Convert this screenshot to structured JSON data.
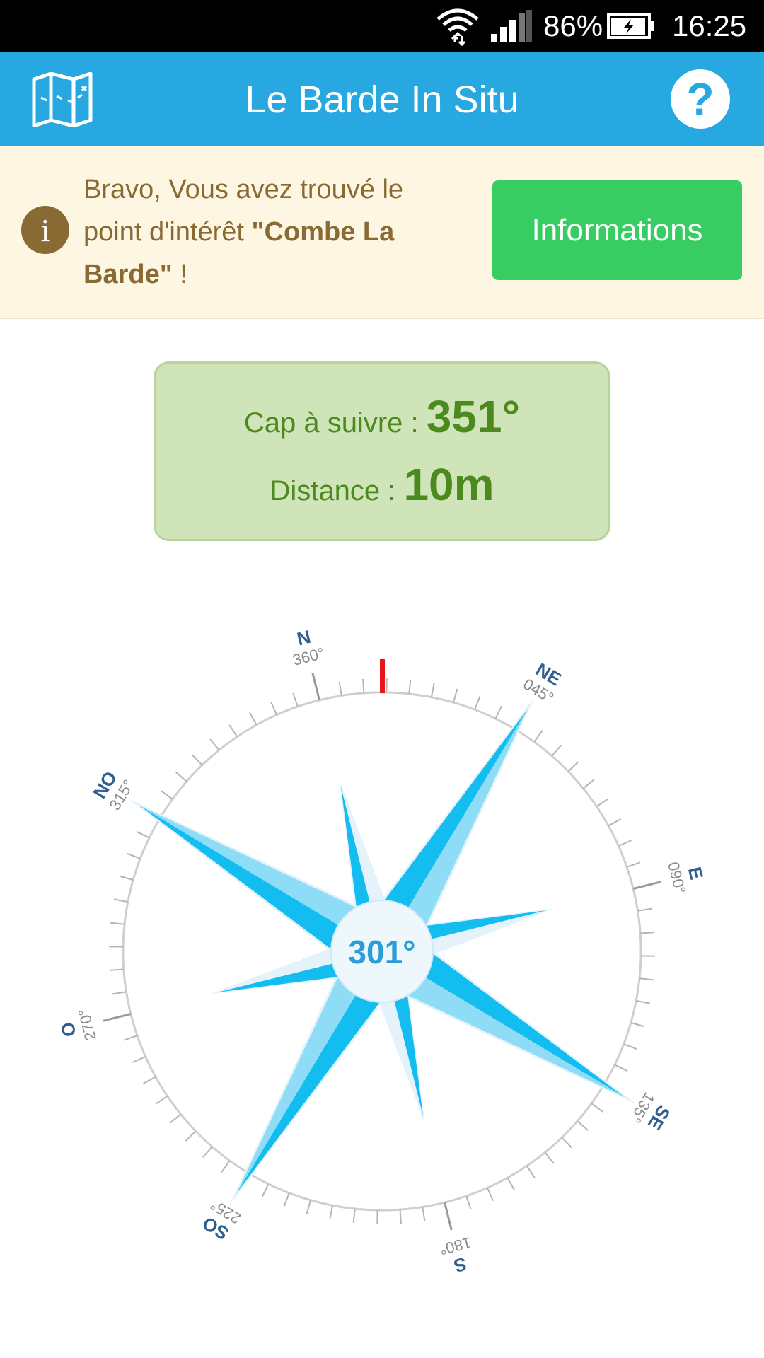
{
  "status_bar": {
    "battery": "86%",
    "time": "16:25",
    "icons": [
      "wifi-icon",
      "signal-icon",
      "battery-charging-icon"
    ]
  },
  "app_bar": {
    "title": "Le Barde In Situ",
    "left_icon": "map-icon",
    "right_icon": "help-icon",
    "help_glyph": "?",
    "color": "#27a8e0"
  },
  "banner": {
    "icon_glyph": "i",
    "text_before": "Bravo, Vous avez trouvé le point d'intérêt ",
    "text_bold": "\"Combe La Barde\"",
    "text_after": " !",
    "button_label": "Informations",
    "button_color": "#37cd62"
  },
  "heading": {
    "cap_label": "Cap à suivre : ",
    "cap_value": "351°",
    "distance_label": "Distance : ",
    "distance_value": "10m"
  },
  "compass": {
    "current_heading": "301°",
    "cardinal_labels": [
      {
        "name": "NO",
        "degrees": "315°"
      },
      {
        "name": "N",
        "degrees": "360°"
      },
      {
        "name": "NE",
        "degrees": "045°"
      },
      {
        "name": "E",
        "degrees": "090°"
      },
      {
        "name": "SE",
        "degrees": "135°"
      },
      {
        "name": "S",
        "degrees": "180°"
      },
      {
        "name": "SO",
        "degrees": "225°"
      },
      {
        "name": "O",
        "degrees": "270°"
      }
    ],
    "rose_color": "#14bdf0",
    "indicator_color": "#e8141e"
  }
}
